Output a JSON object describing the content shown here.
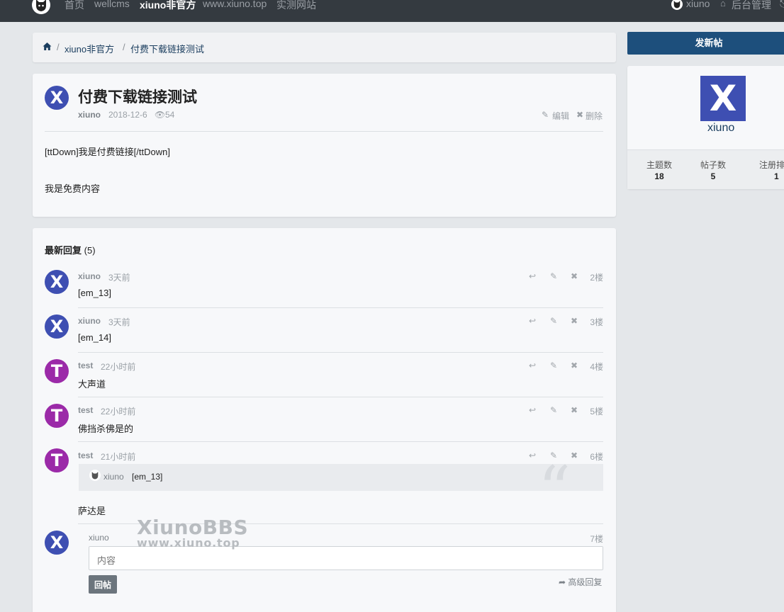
{
  "nav": {
    "links": [
      "首页",
      "wellcms",
      "xiuno非官方",
      "www.xiuno.top",
      "实测网站"
    ],
    "user": "xiuno",
    "admin": "后台管理"
  },
  "breadcrumb": [
    "xiuno非官方",
    "付费下载链接测试"
  ],
  "thread": {
    "avatar_letter": "X",
    "title": "付费下载链接测试",
    "author": "xiuno",
    "date": "2018-12-6",
    "views": "54",
    "edit": "编辑",
    "delete": "删除",
    "content": [
      "[ttDown]我是付费链接[/ttDown]",
      "我是免费内容"
    ]
  },
  "replies": {
    "title": "最新回复",
    "count": "(5)",
    "items": [
      {
        "avatar_letter": "X",
        "user": "xiuno",
        "time": "3天前",
        "content": "[em_13]",
        "floor": "2楼"
      },
      {
        "avatar_letter": "X",
        "user": "xiuno",
        "time": "3天前",
        "content": "[em_14]",
        "floor": "3楼"
      },
      {
        "avatar_letter": "T",
        "user": "test",
        "time": "22小时前",
        "content": "大声道",
        "floor": "4楼"
      },
      {
        "avatar_letter": "T",
        "user": "test",
        "time": "22小时前",
        "content": "佛挡杀佛是的",
        "floor": "5楼"
      },
      {
        "avatar_letter": "T",
        "user": "test",
        "time": "21小时前",
        "quote_user": "xiuno",
        "quote_text": "[em_13]",
        "content": "萨达是",
        "floor": "6楼"
      }
    ],
    "form": {
      "avatar_letter": "X",
      "user": "xiuno",
      "floor": "7楼",
      "placeholder": "内容",
      "submit": "回帖",
      "advanced": "高级回复"
    }
  },
  "watermark": {
    "line1": "XiunoBBS",
    "line2": "www.xiuno.top"
  },
  "sidebar": {
    "new_thread": "发新帖",
    "avatar_letter": "X",
    "username": "xiuno",
    "stats": [
      {
        "label": "主题数",
        "value": "18"
      },
      {
        "label": "帖子数",
        "value": "5"
      },
      {
        "label": "注册排名",
        "value": "1"
      }
    ]
  },
  "colors": {
    "navbar": "#343a40",
    "primary": "#1d4f7c",
    "avatar_x": "#3e4fb2",
    "avatar_t": "#9b2aa8"
  }
}
